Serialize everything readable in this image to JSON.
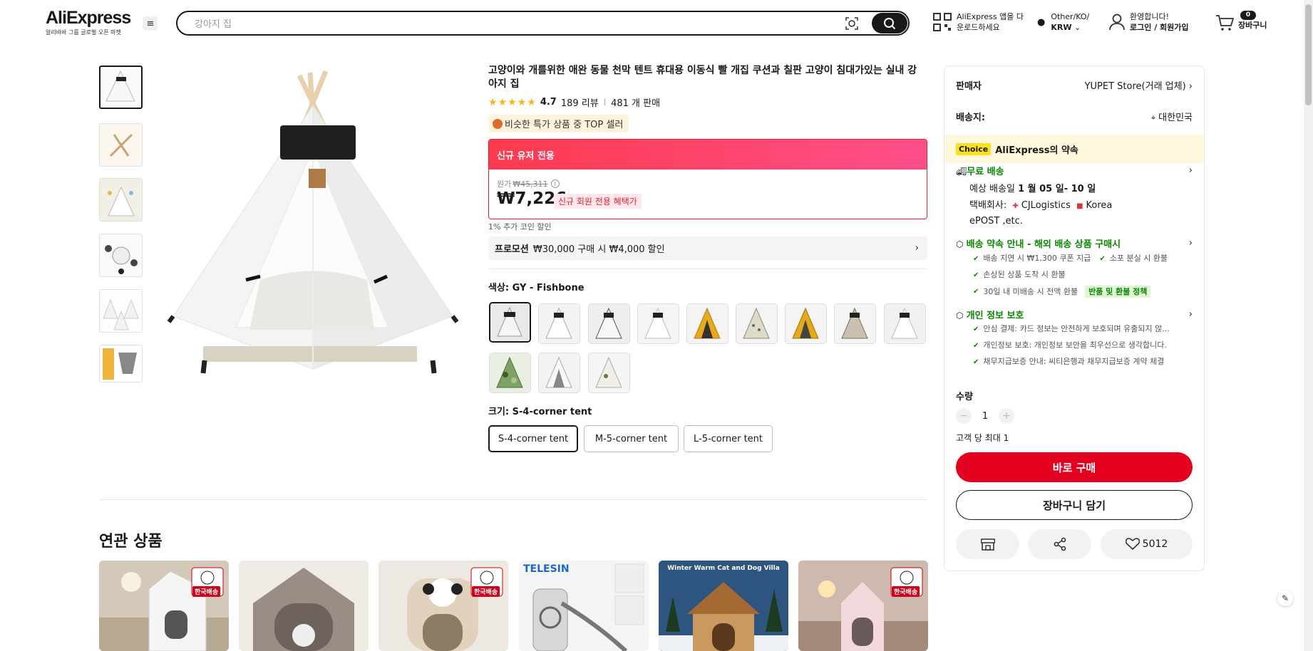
{
  "header": {
    "logo": "AliExpress",
    "logo_sub": "알리바바 그룹 글로벌 오픈 마켓",
    "search_placeholder": "강아지 집",
    "app_line1": "AliExpress 앱을 다",
    "app_line2": "운로드하세요",
    "region_line1": "Other/KO/",
    "region_line2": "KRW",
    "account_line1": "환영합니다!",
    "account_line2": "로그인 / 회원가입",
    "cart_count": "0",
    "cart_label": "장바구니"
  },
  "product": {
    "title": "고양이와 개를위한 애완 동물 천막 텐트 휴대용 이동식 빨 개집 쿠션과 칠판 고양이 침대가있는 실내 강아지 집",
    "rating": "4.7",
    "reviews": "189 리뷰",
    "sold": "481 개 판매",
    "top_seller": "비슷한 특가 상품 중 TOP 셀러",
    "offer_header": "신규 유저 전용",
    "orig_label": "원가",
    "orig_price": "₩45,311",
    "price": "₩7,226",
    "price_tag": "신규 회원 전용 혜택가",
    "coin_note": "1% 추가 코인 할인",
    "promo_label": "프로모션",
    "promo_text": "₩30,000 구매 시 ₩4,000 할인",
    "color_label": "색상: GY - Fishbone",
    "size_label": "크기: S-4-corner tent",
    "sizes": [
      "S-4-corner tent",
      "M-5-corner tent",
      "L-5-corner tent"
    ],
    "related_title": "연관 상품",
    "card_tag": "한국배송",
    "card_brand": "TELESIN",
    "card_title": "Winter Warm Cat and Dog Villa"
  },
  "panel": {
    "seller_label": "판매자",
    "seller_value": "YUPET Store(거래 업체)",
    "ship_label": "배송지:",
    "ship_value": "대한민국",
    "choice_tag": "Choice",
    "choice_text": "AliExpress의 약속",
    "free_ship": "무료 배송",
    "eta_prefix": "예상 배송일",
    "eta_value": "1 월 05 일- 10 일",
    "carrier_prefix": "택배회사:",
    "carrier1": "CJLogistics",
    "carrier2": "Korea",
    "carrier3": "ePOST ,etc.",
    "promise_title": "배송 약속 안내 - 해외 배송 상품 구매시",
    "promise1": "배송 지연 시 ₩1,300 쿠폰 지급",
    "promise2": "소포 분실 시 환불",
    "promise3": "손상된 상품 도착 시 환불",
    "promise4": "30일 내 미배송 시 전액 환불",
    "refund_tag": "반품 및 환불 정책",
    "privacy_title": "개인 정보 보호",
    "privacy1": "안심 결제: 카드 정보는 안전하게 보호되며 유출되지 않...",
    "privacy2": "개인정보 보호: 개인정보 보안을 최우선으로 생각합니다.",
    "privacy3": "채무지급보증 안내: 씨티은행과 채무지급보증 계약 체결",
    "qty_label": "수량",
    "qty_value": "1",
    "qty_limit": "고객 당 최대 1",
    "buy_label": "바로 구매",
    "cart_label": "장바구니 담기",
    "wish_count": "5012"
  }
}
